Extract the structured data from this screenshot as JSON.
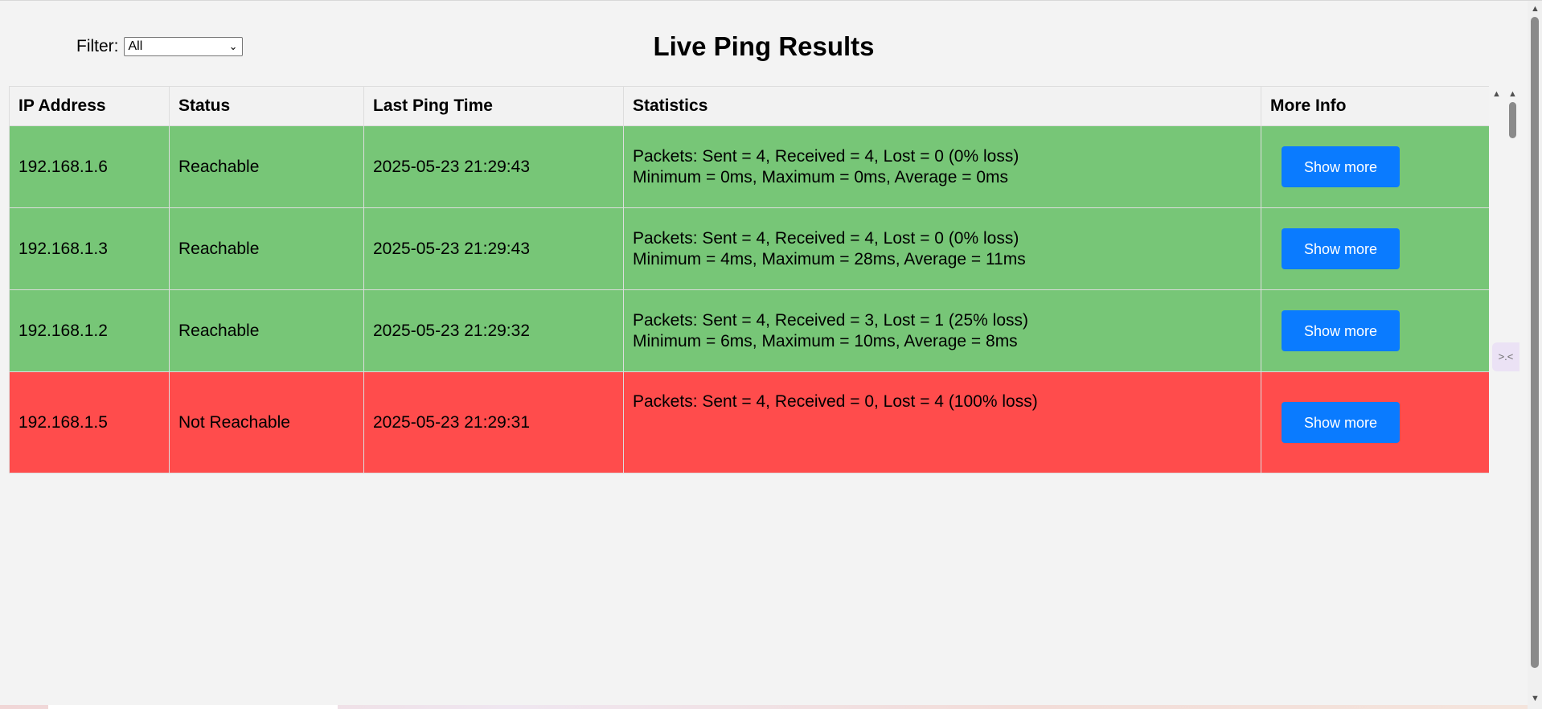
{
  "filter": {
    "label": "Filter:",
    "selected": "All"
  },
  "title": "Live Ping Results",
  "table": {
    "headers": [
      "IP Address",
      "Status",
      "Last Ping Time",
      "Statistics",
      "More Info"
    ],
    "rows": [
      {
        "ip": "192.168.1.6",
        "status": "Reachable",
        "time": "2025-05-23 21:29:43",
        "stats_line1": "Packets: Sent = 4, Received = 4, Lost = 0 (0% loss)",
        "stats_line2": "Minimum = 0ms, Maximum = 0ms, Average = 0ms",
        "button": "Show more"
      },
      {
        "ip": "192.168.1.3",
        "status": "Reachable",
        "time": "2025-05-23 21:29:43",
        "stats_line1": "Packets: Sent = 4, Received = 4, Lost = 0 (0% loss)",
        "stats_line2": "Minimum = 4ms, Maximum = 28ms, Average = 11ms",
        "button": "Show more"
      },
      {
        "ip": "192.168.1.2",
        "status": "Reachable",
        "time": "2025-05-23 21:29:32",
        "stats_line1": "Packets: Sent = 4, Received = 3, Lost = 1 (25% loss)",
        "stats_line2": "Minimum = 6ms, Maximum = 10ms, Average = 8ms",
        "button": "Show more"
      },
      {
        "ip": "192.168.1.5",
        "status": "Not Reachable",
        "time": "2025-05-23 21:29:31",
        "stats_line1": "Packets: Sent = 4, Received = 0, Lost = 4 (100% loss)",
        "stats_line2": "",
        "button": "Show more"
      }
    ]
  },
  "colors": {
    "reachable_row": "#77c677",
    "unreachable_row": "#ff4c4c",
    "button": "#0a7bff",
    "background": "#f3f3f3"
  },
  "icons": {
    "select_arrow": "chevron-down-icon",
    "side_widget": "collapse-icon"
  }
}
